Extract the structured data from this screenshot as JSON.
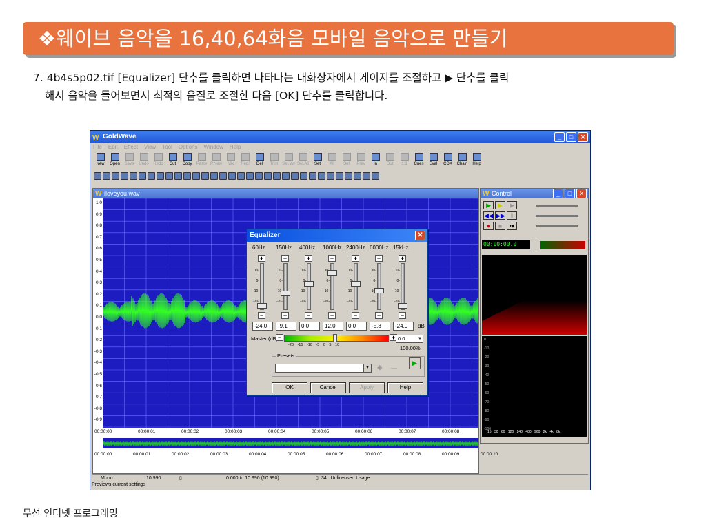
{
  "slide": {
    "title": "❖웨이브 음악을 16,40,64화음 모바일 음악으로 만들기",
    "instruction_line1": "7. 4b4s5p02.tif [Equalizer] 단추를 클릭하면 나타나는 대화상자에서 게이지를 조절하고 ▶ 단추를 클릭",
    "instruction_line2": "해서 음악을 들어보면서 최적의 음질로 조절한 다음 [OK] 단추를 클릭합니다.",
    "footer": "무선 인터넷 프로그래밍"
  },
  "app": {
    "title": "GoldWave",
    "menu": [
      "File",
      "Edit",
      "Effect",
      "View",
      "Tool",
      "Options",
      "Window",
      "Help"
    ],
    "toolbar": [
      {
        "label": "New",
        "enabled": true
      },
      {
        "label": "Open",
        "enabled": true
      },
      {
        "label": "Save",
        "enabled": false
      },
      {
        "label": "Undo",
        "enabled": false
      },
      {
        "label": "Redo",
        "enabled": false
      },
      {
        "label": "Cut",
        "enabled": true
      },
      {
        "label": "Copy",
        "enabled": true
      },
      {
        "label": "Paste",
        "enabled": false
      },
      {
        "label": "P.New",
        "enabled": false
      },
      {
        "label": "Mix",
        "enabled": false
      },
      {
        "label": "Repl",
        "enabled": false
      },
      {
        "label": "Del",
        "enabled": true
      },
      {
        "label": "Trim",
        "enabled": false
      },
      {
        "label": "Sel.Vw",
        "enabled": false
      },
      {
        "label": "Sel.All",
        "enabled": false
      },
      {
        "label": "Set",
        "enabled": true
      },
      {
        "label": "All",
        "enabled": false
      },
      {
        "label": "Sel",
        "enabled": false
      },
      {
        "label": "Prev",
        "enabled": false
      },
      {
        "label": "In",
        "enabled": true
      },
      {
        "label": "Out",
        "enabled": false
      },
      {
        "label": "1:1",
        "enabled": false
      },
      {
        "label": "Cues",
        "enabled": true
      },
      {
        "label": "Eval",
        "enabled": true
      },
      {
        "label": "CDX",
        "enabled": true
      },
      {
        "label": "Chain",
        "enabled": true
      },
      {
        "label": "Help",
        "enabled": true
      }
    ]
  },
  "wave_window": {
    "title": "iloveyou.wav",
    "y_labels": [
      "1.0",
      "0.9",
      "0.8",
      "0.7",
      "0.6",
      "0.5",
      "0.4",
      "0.3",
      "0.2",
      "0.1",
      "0.0",
      "-0.1",
      "-0.2",
      "-0.3",
      "-0.4",
      "-0.5",
      "-0.6",
      "-0.7",
      "-0.8",
      "-0.9"
    ],
    "timeline": [
      "00:00:00",
      "00:00:01",
      "00:00:02",
      "00:00:03",
      "00:00:04",
      "00:00:05",
      "00:00:06",
      "00:00:07",
      "00:00:08"
    ],
    "overview_timeline": [
      "00:00:00",
      "00:00:01",
      "00:00:02",
      "00:00:03",
      "00:00:04",
      "00:00:05",
      "00:00:06",
      "00:00:07",
      "00:00:08",
      "00:00:09",
      "00:00:10"
    ]
  },
  "status": {
    "channel": "Mono",
    "length": "10.990",
    "selection": "0.000 to 10.990 (10.990)",
    "license": "34 : Unlicensed Usage",
    "hint": "Previews current settings"
  },
  "control": {
    "title": "Control",
    "counter": "00:00:00.0",
    "scale": [
      "0",
      "-10",
      "-20",
      "-30",
      "-40",
      "-50",
      "-60",
      "-70",
      "-80",
      "-90",
      "-100"
    ],
    "freqs": "15 30 60 120 240 480 960 2k 4k 8k"
  },
  "equalizer": {
    "title": "Equalizer",
    "bands": [
      {
        "freq": "60Hz",
        "value": "-24.0"
      },
      {
        "freq": "150Hz",
        "value": "-9.1"
      },
      {
        "freq": "400Hz",
        "value": "0.0"
      },
      {
        "freq": "1000Hz",
        "value": "12.0"
      },
      {
        "freq": "2400Hz",
        "value": "0.0"
      },
      {
        "freq": "6000Hz",
        "value": "-5.8"
      },
      {
        "freq": "15kHz",
        "value": "-24.0"
      }
    ],
    "ticks": [
      "10-",
      "0-",
      "-10-",
      "-20-"
    ],
    "db_unit": "dB",
    "master_label": "Master (dB):",
    "master_value": "0.0",
    "master_scale": "-20 -15 -10 -5 0 5 10",
    "master_percent": "100.00%",
    "presets_label": "Presets",
    "buttons": {
      "ok": "OK",
      "cancel": "Cancel",
      "apply": "Apply",
      "help": "Help"
    }
  }
}
